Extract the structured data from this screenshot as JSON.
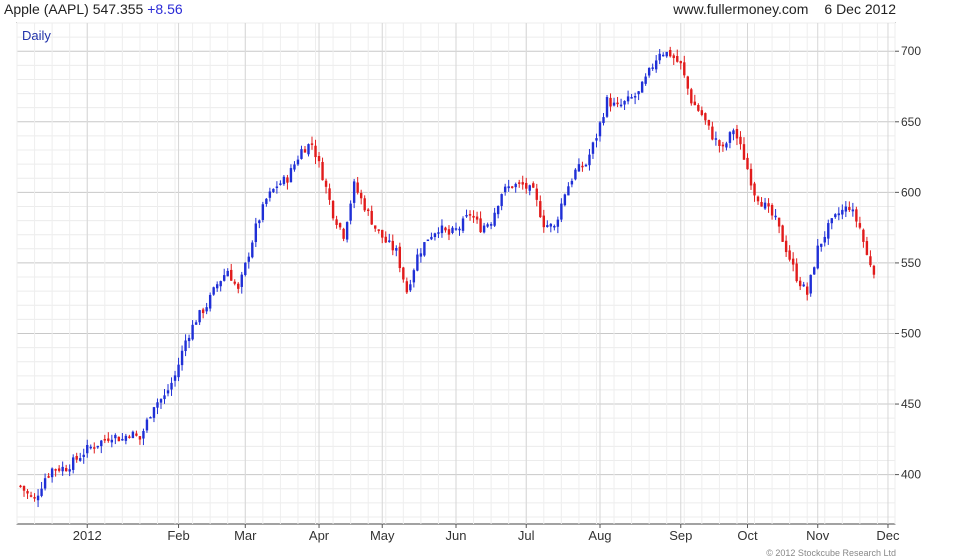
{
  "header": {
    "instrument": "Apple (AAPL)",
    "price": "547.355",
    "change": "+8.56",
    "source": "www.fullermoney.com",
    "date": "6 Dec 2012"
  },
  "period_label": "Daily",
  "copyright": "© 2012 Stockcube Research Ltd",
  "colors": {
    "up": "#1f2fd6",
    "down": "#e11b1b",
    "grid": "#dcdcdc",
    "axis": "#555555",
    "period_label": "#2233aa"
  },
  "chart_data": {
    "type": "candlestick",
    "title": "Apple (AAPL)",
    "ylim": [
      365,
      720
    ],
    "grid": true,
    "y_axis_position": "right",
    "y_ticks": [
      400,
      450,
      500,
      550,
      600,
      650,
      700
    ],
    "x_ticks": [
      {
        "label": "2012",
        "day": 5
      },
      {
        "label": "Feb",
        "day": 31
      },
      {
        "label": "Mar",
        "day": 50
      },
      {
        "label": "Apr",
        "day": 71
      },
      {
        "label": "May",
        "day": 89
      },
      {
        "label": "Jun",
        "day": 110
      },
      {
        "label": "Jul",
        "day": 130
      },
      {
        "label": "Aug",
        "day": 151
      },
      {
        "label": "Sep",
        "day": 174
      },
      {
        "label": "Oct",
        "day": 193
      },
      {
        "label": "Nov",
        "day": 213
      },
      {
        "label": "Dec",
        "day": 233
      }
    ],
    "day_range": [
      -15,
      235
    ],
    "series": [
      {
        "name": "AAPL",
        "anchors": [
          [
            -14,
            392
          ],
          [
            -12,
            386
          ],
          [
            -10,
            382
          ],
          [
            -7,
            398
          ],
          [
            -5,
            404
          ],
          [
            -1,
            405
          ],
          [
            2,
            411
          ],
          [
            5,
            418
          ],
          [
            8,
            422
          ],
          [
            12,
            428
          ],
          [
            15,
            425
          ],
          [
            17,
            430
          ],
          [
            20,
            425
          ],
          [
            24,
            450
          ],
          [
            27,
            455
          ],
          [
            30,
            470
          ],
          [
            33,
            495
          ],
          [
            36,
            510
          ],
          [
            39,
            520
          ],
          [
            42,
            535
          ],
          [
            45,
            545
          ],
          [
            48,
            530
          ],
          [
            50,
            548
          ],
          [
            53,
            575
          ],
          [
            56,
            595
          ],
          [
            59,
            605
          ],
          [
            62,
            610
          ],
          [
            66,
            630
          ],
          [
            69,
            635
          ],
          [
            72,
            612
          ],
          [
            75,
            585
          ],
          [
            78,
            570
          ],
          [
            81,
            605
          ],
          [
            84,
            590
          ],
          [
            87,
            575
          ],
          [
            90,
            565
          ],
          [
            93,
            558
          ],
          [
            96,
            530
          ],
          [
            99,
            555
          ],
          [
            102,
            568
          ],
          [
            105,
            575
          ],
          [
            108,
            570
          ],
          [
            111,
            575
          ],
          [
            114,
            585
          ],
          [
            117,
            575
          ],
          [
            120,
            580
          ],
          [
            123,
            600
          ],
          [
            126,
            605
          ],
          [
            129,
            605
          ],
          [
            132,
            600
          ],
          [
            135,
            578
          ],
          [
            138,
            575
          ],
          [
            141,
            600
          ],
          [
            144,
            615
          ],
          [
            147,
            620
          ],
          [
            150,
            640
          ],
          [
            153,
            665
          ],
          [
            156,
            660
          ],
          [
            159,
            665
          ],
          [
            162,
            670
          ],
          [
            165,
            685
          ],
          [
            168,
            700
          ],
          [
            171,
            698
          ],
          [
            174,
            690
          ],
          [
            177,
            665
          ],
          [
            180,
            655
          ],
          [
            183,
            640
          ],
          [
            186,
            630
          ],
          [
            189,
            645
          ],
          [
            192,
            625
          ],
          [
            195,
            600
          ],
          [
            198,
            590
          ],
          [
            201,
            580
          ],
          [
            204,
            560
          ],
          [
            207,
            540
          ],
          [
            210,
            528
          ],
          [
            213,
            560
          ],
          [
            216,
            575
          ],
          [
            219,
            585
          ],
          [
            222,
            590
          ],
          [
            225,
            575
          ],
          [
            227,
            555
          ],
          [
            229,
            545
          ]
        ]
      }
    ]
  }
}
